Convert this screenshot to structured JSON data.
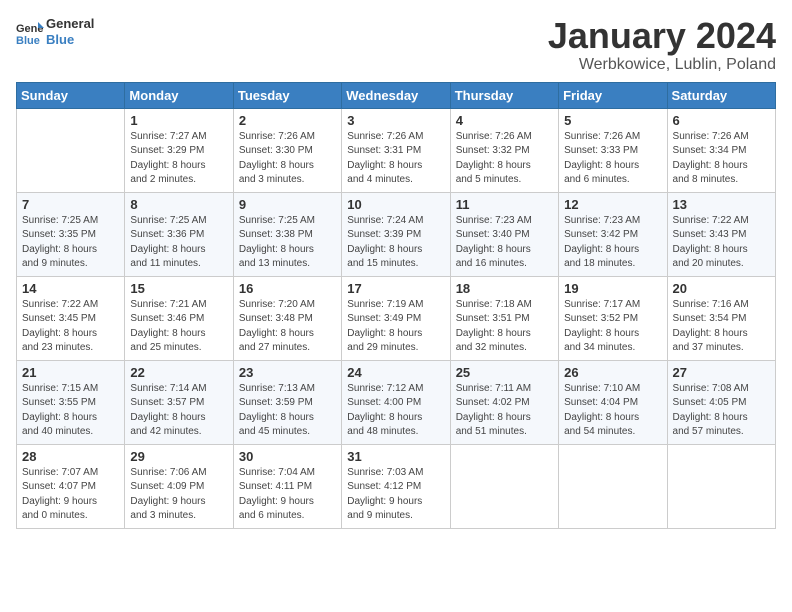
{
  "header": {
    "logo_line1": "General",
    "logo_line2": "Blue",
    "title": "January 2024",
    "location": "Werbkowice, Lublin, Poland"
  },
  "days_of_week": [
    "Sunday",
    "Monday",
    "Tuesday",
    "Wednesday",
    "Thursday",
    "Friday",
    "Saturday"
  ],
  "weeks": [
    [
      {
        "day": "",
        "info": ""
      },
      {
        "day": "1",
        "info": "Sunrise: 7:27 AM\nSunset: 3:29 PM\nDaylight: 8 hours\nand 2 minutes."
      },
      {
        "day": "2",
        "info": "Sunrise: 7:26 AM\nSunset: 3:30 PM\nDaylight: 8 hours\nand 3 minutes."
      },
      {
        "day": "3",
        "info": "Sunrise: 7:26 AM\nSunset: 3:31 PM\nDaylight: 8 hours\nand 4 minutes."
      },
      {
        "day": "4",
        "info": "Sunrise: 7:26 AM\nSunset: 3:32 PM\nDaylight: 8 hours\nand 5 minutes."
      },
      {
        "day": "5",
        "info": "Sunrise: 7:26 AM\nSunset: 3:33 PM\nDaylight: 8 hours\nand 6 minutes."
      },
      {
        "day": "6",
        "info": "Sunrise: 7:26 AM\nSunset: 3:34 PM\nDaylight: 8 hours\nand 8 minutes."
      }
    ],
    [
      {
        "day": "7",
        "info": "Sunrise: 7:25 AM\nSunset: 3:35 PM\nDaylight: 8 hours\nand 9 minutes."
      },
      {
        "day": "8",
        "info": "Sunrise: 7:25 AM\nSunset: 3:36 PM\nDaylight: 8 hours\nand 11 minutes."
      },
      {
        "day": "9",
        "info": "Sunrise: 7:25 AM\nSunset: 3:38 PM\nDaylight: 8 hours\nand 13 minutes."
      },
      {
        "day": "10",
        "info": "Sunrise: 7:24 AM\nSunset: 3:39 PM\nDaylight: 8 hours\nand 15 minutes."
      },
      {
        "day": "11",
        "info": "Sunrise: 7:23 AM\nSunset: 3:40 PM\nDaylight: 8 hours\nand 16 minutes."
      },
      {
        "day": "12",
        "info": "Sunrise: 7:23 AM\nSunset: 3:42 PM\nDaylight: 8 hours\nand 18 minutes."
      },
      {
        "day": "13",
        "info": "Sunrise: 7:22 AM\nSunset: 3:43 PM\nDaylight: 8 hours\nand 20 minutes."
      }
    ],
    [
      {
        "day": "14",
        "info": "Sunrise: 7:22 AM\nSunset: 3:45 PM\nDaylight: 8 hours\nand 23 minutes."
      },
      {
        "day": "15",
        "info": "Sunrise: 7:21 AM\nSunset: 3:46 PM\nDaylight: 8 hours\nand 25 minutes."
      },
      {
        "day": "16",
        "info": "Sunrise: 7:20 AM\nSunset: 3:48 PM\nDaylight: 8 hours\nand 27 minutes."
      },
      {
        "day": "17",
        "info": "Sunrise: 7:19 AM\nSunset: 3:49 PM\nDaylight: 8 hours\nand 29 minutes."
      },
      {
        "day": "18",
        "info": "Sunrise: 7:18 AM\nSunset: 3:51 PM\nDaylight: 8 hours\nand 32 minutes."
      },
      {
        "day": "19",
        "info": "Sunrise: 7:17 AM\nSunset: 3:52 PM\nDaylight: 8 hours\nand 34 minutes."
      },
      {
        "day": "20",
        "info": "Sunrise: 7:16 AM\nSunset: 3:54 PM\nDaylight: 8 hours\nand 37 minutes."
      }
    ],
    [
      {
        "day": "21",
        "info": "Sunrise: 7:15 AM\nSunset: 3:55 PM\nDaylight: 8 hours\nand 40 minutes."
      },
      {
        "day": "22",
        "info": "Sunrise: 7:14 AM\nSunset: 3:57 PM\nDaylight: 8 hours\nand 42 minutes."
      },
      {
        "day": "23",
        "info": "Sunrise: 7:13 AM\nSunset: 3:59 PM\nDaylight: 8 hours\nand 45 minutes."
      },
      {
        "day": "24",
        "info": "Sunrise: 7:12 AM\nSunset: 4:00 PM\nDaylight: 8 hours\nand 48 minutes."
      },
      {
        "day": "25",
        "info": "Sunrise: 7:11 AM\nSunset: 4:02 PM\nDaylight: 8 hours\nand 51 minutes."
      },
      {
        "day": "26",
        "info": "Sunrise: 7:10 AM\nSunset: 4:04 PM\nDaylight: 8 hours\nand 54 minutes."
      },
      {
        "day": "27",
        "info": "Sunrise: 7:08 AM\nSunset: 4:05 PM\nDaylight: 8 hours\nand 57 minutes."
      }
    ],
    [
      {
        "day": "28",
        "info": "Sunrise: 7:07 AM\nSunset: 4:07 PM\nDaylight: 9 hours\nand 0 minutes."
      },
      {
        "day": "29",
        "info": "Sunrise: 7:06 AM\nSunset: 4:09 PM\nDaylight: 9 hours\nand 3 minutes."
      },
      {
        "day": "30",
        "info": "Sunrise: 7:04 AM\nSunset: 4:11 PM\nDaylight: 9 hours\nand 6 minutes."
      },
      {
        "day": "31",
        "info": "Sunrise: 7:03 AM\nSunset: 4:12 PM\nDaylight: 9 hours\nand 9 minutes."
      },
      {
        "day": "",
        "info": ""
      },
      {
        "day": "",
        "info": ""
      },
      {
        "day": "",
        "info": ""
      }
    ]
  ]
}
